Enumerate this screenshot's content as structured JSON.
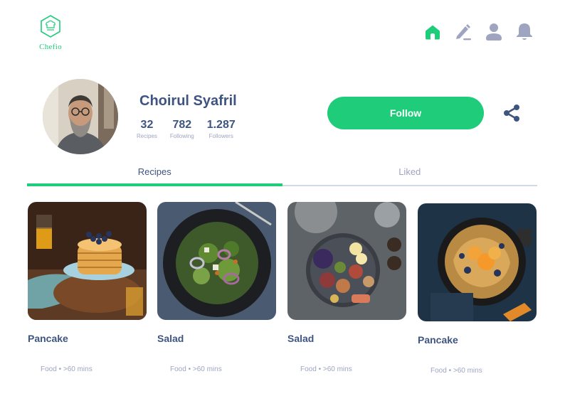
{
  "brand": {
    "name": "Chefio",
    "color": "#1fcc79"
  },
  "nav": [
    {
      "icon": "home-icon",
      "active": true
    },
    {
      "icon": "edit-icon",
      "active": false
    },
    {
      "icon": "profile-icon",
      "active": false
    },
    {
      "icon": "bell-icon",
      "active": false
    }
  ],
  "profile": {
    "name": "Choirul Syafril",
    "stats": [
      {
        "value": "32",
        "label": "Recipes"
      },
      {
        "value": "782",
        "label": "Following"
      },
      {
        "value": "1.287",
        "label": "Followers"
      }
    ],
    "follow_label": "Follow",
    "share_icon": "share-icon"
  },
  "tabs": [
    {
      "label": "Recipes",
      "active": true
    },
    {
      "label": "Liked",
      "active": false
    }
  ],
  "recipes": [
    {
      "title": "Pancake",
      "category": "Food",
      "time": ">60 mins"
    },
    {
      "title": "Salad",
      "category": "Food",
      "time": ">60 mins"
    },
    {
      "title": "Salad",
      "category": "Food",
      "time": ">60 mins"
    },
    {
      "title": "Pancake",
      "category": "Food",
      "time": ">60 mins"
    }
  ],
  "colors": {
    "primary": "#1fcc79",
    "text": "#3e5481",
    "muted": "#9fa5c0",
    "icon_inactive": "#9fa5c0"
  }
}
